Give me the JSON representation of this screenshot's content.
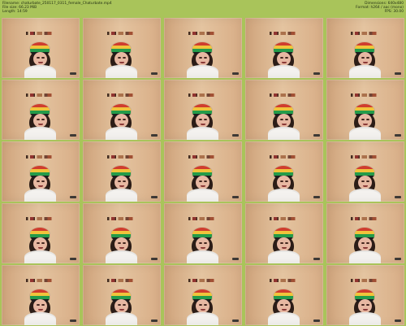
{
  "header": {
    "filename_label": "Filename:",
    "filename_value": "chaturbate_250117_0311_female_Chaturbate.mp4",
    "filesize_label": "File size:",
    "filesize_value": "66.23 MiB",
    "length_label": "Length:",
    "length_value": "14:59",
    "dimensions_label": "Dimensions:",
    "dimensions_value": "640x480",
    "format_label": "Format:",
    "format_value": "h264 / aac (mono)",
    "fps_label": "FPS:",
    "fps_value": "30.00"
  },
  "thumbnails": {
    "count": 25
  }
}
